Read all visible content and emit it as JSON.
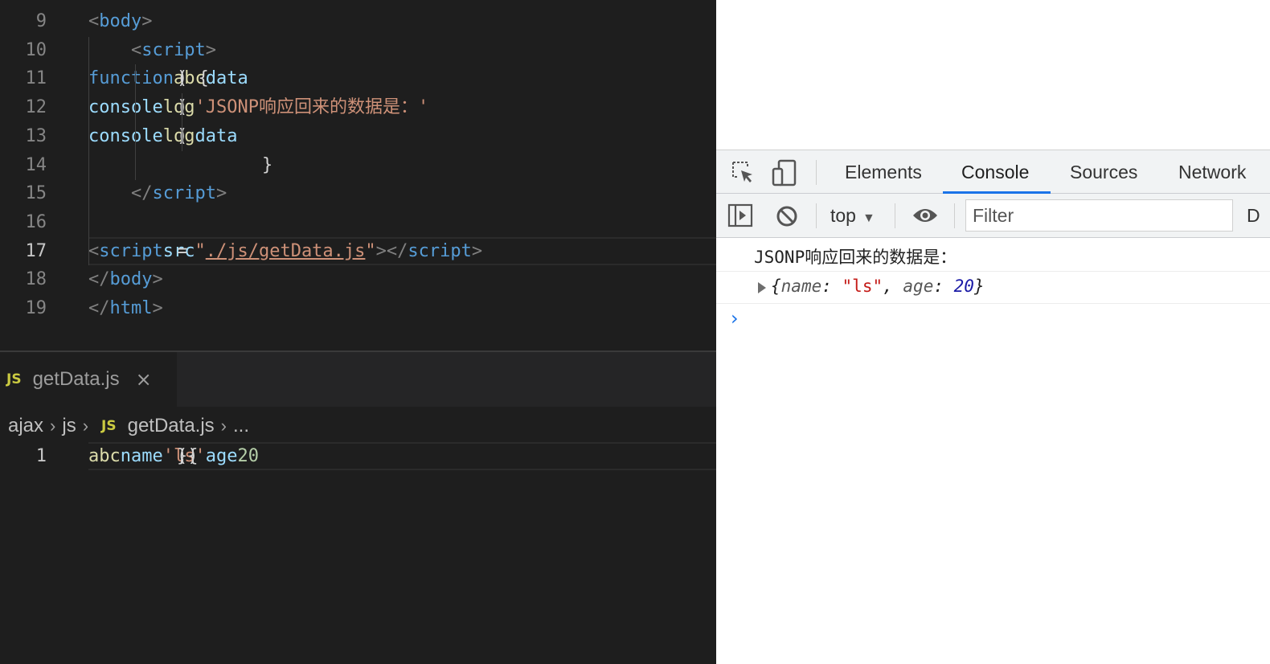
{
  "editor": {
    "lines": [
      {
        "num": "9",
        "parts": [
          [
            "pun",
            "<"
          ],
          [
            "tag",
            "body"
          ],
          [
            "pun",
            ">"
          ]
        ]
      },
      {
        "num": "10",
        "parts": [
          [
            "pun",
            "    <"
          ],
          [
            "tag",
            "script"
          ],
          [
            "pun",
            ">"
          ]
        ]
      },
      {
        "num": "11",
        "parts": [
          [
            "src",
            "        "
          ],
          [
            "kw",
            "function"
          ],
          [
            "src",
            " "
          ],
          [
            "fn",
            "abc"
          ],
          [
            "src",
            "("
          ],
          [
            "var",
            "data"
          ],
          [
            "src",
            ") {"
          ]
        ]
      },
      {
        "num": "12",
        "parts": [
          [
            "src",
            "            "
          ],
          [
            "var",
            "console"
          ],
          [
            "src",
            "."
          ],
          [
            "fn",
            "log"
          ],
          [
            "src",
            "("
          ],
          [
            "str",
            "'JSONP响应回来的数据是：'"
          ],
          [
            "src",
            ")"
          ]
        ]
      },
      {
        "num": "13",
        "parts": [
          [
            "src",
            "            "
          ],
          [
            "var",
            "console"
          ],
          [
            "src",
            "."
          ],
          [
            "fn",
            "log"
          ],
          [
            "src",
            "("
          ],
          [
            "var",
            "data"
          ],
          [
            "src",
            ")"
          ]
        ]
      },
      {
        "num": "14",
        "parts": [
          [
            "src",
            "        }"
          ]
        ]
      },
      {
        "num": "15",
        "parts": [
          [
            "pun",
            "    </"
          ],
          [
            "tag",
            "script"
          ],
          [
            "pun",
            ">"
          ]
        ]
      },
      {
        "num": "16",
        "parts": []
      },
      {
        "num": "17",
        "parts": [
          [
            "src",
            "    "
          ],
          [
            "pun",
            "<"
          ],
          [
            "tag",
            "script"
          ],
          [
            "src",
            " "
          ],
          [
            "attr",
            "src"
          ],
          [
            "src",
            "="
          ],
          [
            "str",
            "\""
          ],
          [
            "strul",
            "./js/getData.js"
          ],
          [
            "str",
            "\""
          ],
          [
            "pun",
            ">"
          ],
          [
            "pun",
            "</"
          ],
          [
            "tag",
            "script"
          ],
          [
            "pun",
            ">"
          ]
        ]
      },
      {
        "num": "18",
        "parts": [
          [
            "pun",
            "</"
          ],
          [
            "tag",
            "body"
          ],
          [
            "pun",
            ">"
          ]
        ]
      },
      {
        "num": "19",
        "parts": [
          [
            "pun",
            "</"
          ],
          [
            "tag",
            "html"
          ],
          [
            "pun",
            ">"
          ]
        ]
      }
    ],
    "active_line": "17"
  },
  "second_editor": {
    "tab": {
      "badge": "JS",
      "label": "getData.js",
      "close": "×"
    },
    "breadcrumb": {
      "items": [
        "ajax",
        "js",
        "getData.js",
        "..."
      ],
      "badge": "JS"
    },
    "lines": [
      {
        "num": "1",
        "parts": [
          [
            "fn",
            "abc"
          ],
          [
            "src",
            "({"
          ],
          [
            "var",
            "name"
          ],
          [
            "src",
            ": "
          ],
          [
            "str",
            "'ls'"
          ],
          [
            "src",
            ", "
          ],
          [
            "var",
            "age"
          ],
          [
            "src",
            ": "
          ],
          [
            "num",
            "20"
          ],
          [
            "src",
            "})"
          ]
        ]
      }
    ]
  },
  "devtools": {
    "tabs": [
      "Elements",
      "Console",
      "Sources",
      "Network"
    ],
    "active_tab": "Console",
    "context": "top",
    "filter_placeholder": "Filter",
    "truncated_label": "D",
    "console": {
      "message": "JSONP响应回来的数据是：",
      "object": {
        "open": "{",
        "name_key": "name",
        "name_val": "\"ls\"",
        "age_key": "age",
        "age_val": "20",
        "close": "}"
      },
      "prompt": "›"
    }
  },
  "colors": {
    "accent": "#1a73e8",
    "editor_bg": "#1e1e1e",
    "string": "#ce9178",
    "tag": "#569cd6"
  }
}
